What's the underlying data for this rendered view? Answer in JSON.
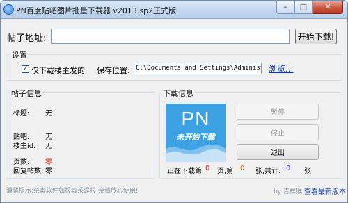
{
  "window": {
    "title": "PN百度贴吧图片批量下载器 v2013 sp2正式版",
    "min_glyph": "–",
    "max_glyph": "□",
    "close_glyph": "✕"
  },
  "url_row": {
    "label": "帖子地址:",
    "value": "",
    "start_button": "开始下载!"
  },
  "settings": {
    "section_label": "设置",
    "only_owner_label": "仅下载楼主发的",
    "only_owner_checked": true,
    "check_glyph": "✓",
    "save_label": "保存位置:",
    "save_path": "C:\\Documents and Settings\\Administrator\\桌",
    "browse_label": "浏览..."
  },
  "post_info": {
    "section_label": "帖子信息",
    "title_label": "标题:",
    "title_value": "无",
    "bar_label": "贴吧:",
    "bar_value": "无",
    "owner_id_label": "楼主id:",
    "owner_id_value": "无",
    "pages_label": "页数:",
    "pages_value": "零",
    "replies_label": "回复帖数:",
    "replies_value": "零"
  },
  "download_info": {
    "section_label": "下载信息",
    "logo_text": "PN",
    "logo_status": "未开始下载",
    "pause_button": "暂停",
    "stop_button": "停止",
    "exit_button": "退出",
    "progress_prefix": "正在下载第",
    "current_page": "0",
    "page_word": "页,第",
    "current_image": "0",
    "image_word": "张,共计:",
    "total_images": "0",
    "total_word": "张"
  },
  "footer": {
    "tip": "温馨提示:杀毒软件如报毒系误报,亲请放心使用!",
    "author": "by 吉祥猴",
    "latest_link": "查看最新版本"
  },
  "colors": {
    "logo_bg": "#3da2e3",
    "link": "#0033cc",
    "highlight_red": "#e01010",
    "count_blue": "#1a2ad0",
    "count_orange": "#d08000"
  }
}
